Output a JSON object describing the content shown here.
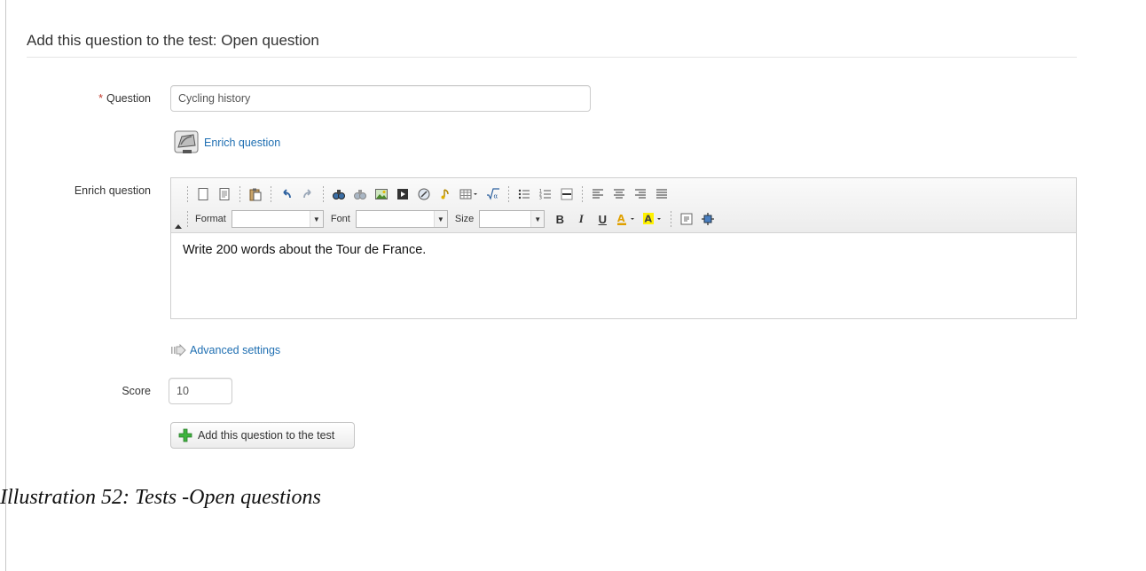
{
  "form": {
    "title": "Add this question to the test: Open question",
    "question_label": "Question",
    "required_mark": "*",
    "question_value": "Cycling history",
    "enrich_link": "Enrich question",
    "enrich_label": "Enrich question",
    "advanced_settings": "Advanced settings",
    "score_label": "Score",
    "score_value": "10",
    "submit_label": "Add this question to the test"
  },
  "editor": {
    "format_label": "Format",
    "font_label": "Font",
    "size_label": "Size",
    "bold": "B",
    "italic": "I",
    "underline": "U",
    "content": "Write 200 words about the Tour de France."
  },
  "caption": "Illustration 52: Tests -Open questions",
  "colors": {
    "link": "#1f6fb2",
    "required": "#c0392b",
    "add_icon": "#3db33d"
  }
}
